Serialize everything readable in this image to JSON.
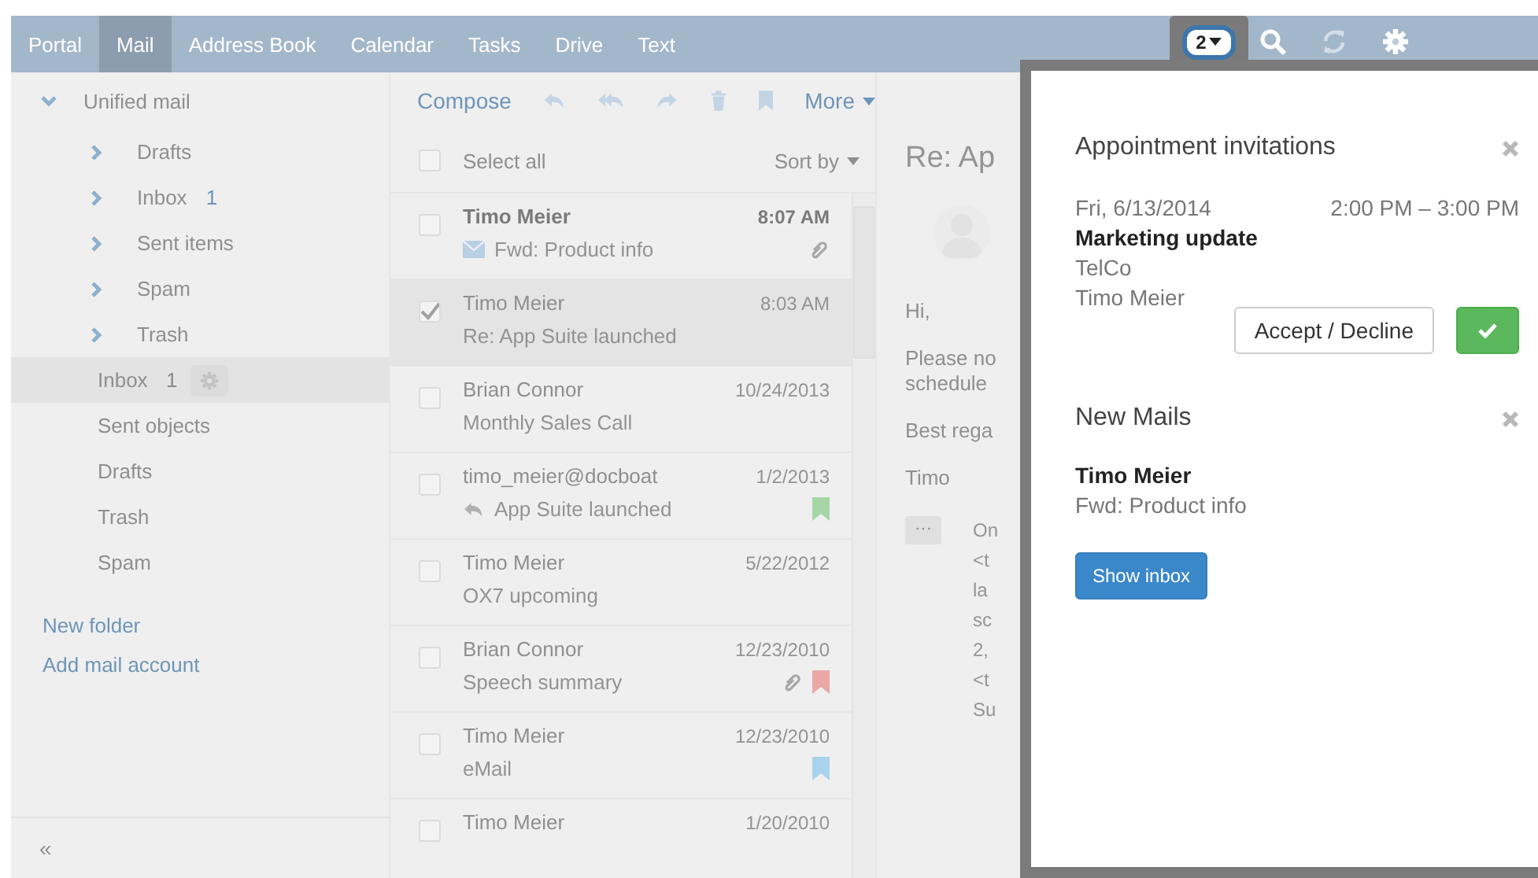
{
  "nav_tabs": [
    {
      "label": "Portal",
      "selected": false
    },
    {
      "label": "Mail",
      "selected": true
    },
    {
      "label": "Address Book",
      "selected": false
    },
    {
      "label": "Calendar",
      "selected": false
    },
    {
      "label": "Tasks",
      "selected": false
    },
    {
      "label": "Drive",
      "selected": false
    },
    {
      "label": "Text",
      "selected": false
    }
  ],
  "notification_badge": "2",
  "sidebar": {
    "account": {
      "label": "Unified mail",
      "expanded": true,
      "children": [
        {
          "label": "Drafts"
        },
        {
          "label": "Inbox",
          "count": "1"
        },
        {
          "label": "Sent items"
        },
        {
          "label": "Spam"
        },
        {
          "label": "Trash"
        }
      ]
    },
    "folders": [
      {
        "label": "Inbox",
        "count": "1",
        "selected": true
      },
      {
        "label": "Sent objects",
        "selected": false
      },
      {
        "label": "Drafts",
        "selected": false
      },
      {
        "label": "Trash",
        "selected": false
      },
      {
        "label": "Spam",
        "selected": false
      }
    ],
    "links": [
      "New folder",
      "Add mail account"
    ],
    "collapse": "«"
  },
  "toolbar": {
    "compose": "Compose",
    "more": "More"
  },
  "list": {
    "select_all": "Select all",
    "select_all_checked": false,
    "sort": "Sort by",
    "rows": [
      {
        "sender": "Timo Meier",
        "subject": "Fwd: Product info",
        "date": "8:07 AM",
        "unread": true,
        "selected": false,
        "kind": "envelope",
        "attachment": true
      },
      {
        "sender": "Timo Meier",
        "subject": "Re: App Suite launched",
        "date": "8:03 AM",
        "unread": false,
        "selected": true
      },
      {
        "sender": "Brian Connor",
        "subject": "Monthly Sales Call",
        "date": "10/24/2013",
        "unread": false,
        "selected": false
      },
      {
        "sender": "timo_meier@docboat",
        "subject": "App Suite launched",
        "date": "1/2/2013",
        "unread": false,
        "selected": false,
        "kind": "reply",
        "color": "#a6d6a6"
      },
      {
        "sender": "Timo Meier",
        "subject": "OX7 upcoming",
        "date": "5/22/2012",
        "unread": false,
        "selected": false
      },
      {
        "sender": "Brian Connor",
        "subject": "Speech summary",
        "date": "12/23/2010",
        "unread": false,
        "selected": false,
        "attachment": true,
        "color": "#eba6a6"
      },
      {
        "sender": "Timo Meier",
        "subject": "eMail",
        "date": "12/23/2010",
        "unread": false,
        "selected": false,
        "color": "#a9d3ec"
      },
      {
        "sender": "Timo Meier",
        "date": "1/20/2010",
        "unread": false,
        "selected": false
      }
    ]
  },
  "detail": {
    "subject": "Re: Ap",
    "body": [
      "Hi,",
      "Please no",
      "schedule",
      "Best rega",
      "Timo"
    ],
    "quote_toggle": "···",
    "quote": [
      "On",
      "<t",
      "la",
      "sc",
      "2,",
      "<t",
      "Su"
    ]
  },
  "popup": {
    "appointments": {
      "title": "Appointment invitations",
      "date": "Fri, 6/13/2014",
      "time": "2:00 PM – 3:00 PM",
      "name": "Marketing update",
      "location": "TelCo",
      "organizer": "Timo Meier",
      "action": "Accept / Decline"
    },
    "mails": {
      "title": "New Mails",
      "sender": "Timo Meier",
      "subject": "Fwd: Product info",
      "action": "Show inbox"
    }
  }
}
